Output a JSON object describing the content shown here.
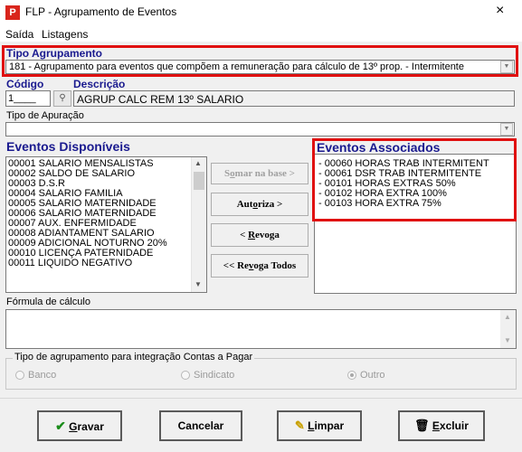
{
  "window": {
    "title": "FLP - Agrupamento de Eventos",
    "close": "×",
    "icon": "P"
  },
  "menu": {
    "items": [
      "Saída",
      "Listagens"
    ]
  },
  "tipo_agrupamento": {
    "label": "Tipo Agrupamento",
    "value": "181 - Agrupamento para eventos que compõem a remuneração para cálculo de 13º prop. - Intermitente"
  },
  "codigo": {
    "label": "Código",
    "value": "1____"
  },
  "descricao": {
    "label": "Descrição",
    "value": "AGRUP CALC REM 13º SALARIO"
  },
  "tipo_apuracao": {
    "label": "Tipo de Apuração",
    "value": ""
  },
  "eventos_disponiveis": {
    "label": "Eventos Disponíveis",
    "items": [
      "00001 SALARIO MENSALISTAS",
      "00002 SALDO DE SALARIO",
      "00003 D.S.R",
      "00004 SALARIO FAMILIA",
      "00005 SALARIO MATERNIDADE",
      "00006 SALARIO MATERNIDADE",
      "00007 AUX. ENFERMIDADE",
      "00008 ADIANTAMENT SALARIO",
      "00009 ADICIONAL NOTURNO 20%",
      "00010 LICENÇA PATERNIDADE",
      "00011 LIQUIDO NEGATIVO"
    ]
  },
  "eventos_associados": {
    "label": "Eventos Associados",
    "items": [
      "- 00060 HORAS TRAB INTERMITENT",
      "- 00061 DSR TRAB INTERMITENTE",
      "- 00101 HORAS EXTRAS 50%",
      "- 00102 HORA EXTRA 100%",
      "- 00103 HORA EXTRA 75%"
    ]
  },
  "buttons": {
    "somar_pre": "S",
    "somar_acc": "o",
    "somar_post": "mar  na base >",
    "autoriza_pre": "Aut",
    "autoriza_acc": "o",
    "autoriza_post": "riza >",
    "revoga_pre": "< ",
    "revoga_acc": "R",
    "revoga_post": "evoga",
    "revoga_todos_pre": "<< Re",
    "revoga_todos_acc": "v",
    "revoga_todos_post": "oga Todos"
  },
  "formula": {
    "label": "Fórmula de cálculo",
    "value": ""
  },
  "contas_pagar": {
    "label": "Tipo de agrupamento para integração Contas a Pagar",
    "options": [
      {
        "label": "Banco",
        "selected": false
      },
      {
        "label": "Sindicato",
        "selected": false
      },
      {
        "label": "Outro",
        "selected": true
      }
    ]
  },
  "footer": {
    "gravar_acc": "G",
    "gravar_post": "ravar",
    "cancelar": "Cancelar",
    "limpar_acc": "L",
    "limpar_post": "impar",
    "excluir_acc": "E",
    "excluir_post": "xcluir"
  },
  "colors": {
    "accent_label": "#1a1a8f",
    "highlight_border": "#e01010"
  }
}
